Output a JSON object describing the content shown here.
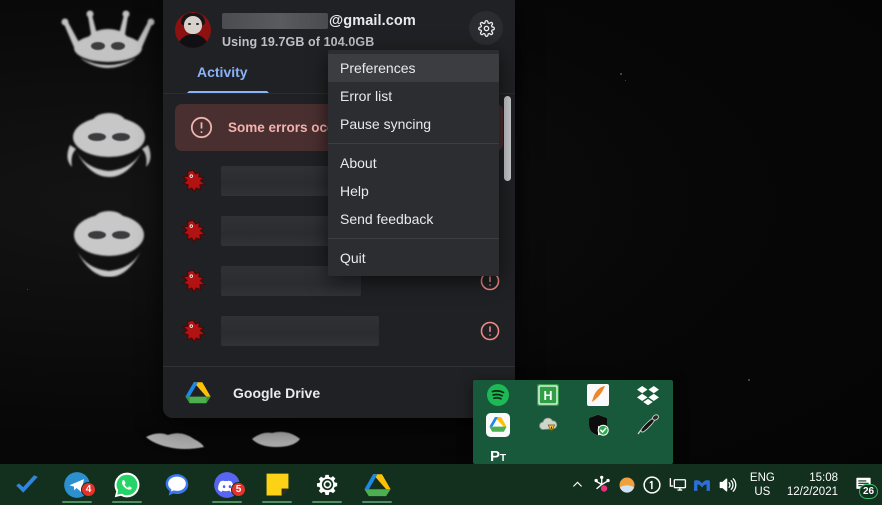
{
  "desktop": {
    "wallpaper_name": "abstract-white-fractal-forms-on-black",
    "background_color": "#060606"
  },
  "drive_panel": {
    "account": {
      "email_redacted": "",
      "email_domain": "@gmail.com",
      "quota_text": "Using 19.7GB of 104.0GB",
      "avatar_name": "user-avatar"
    },
    "settings_icon": "gear-icon",
    "tabs": [
      {
        "label": "Activity",
        "selected": true
      }
    ],
    "error_banner": {
      "icon": "error-circle-icon",
      "text": "Some errors occurred",
      "background_color": "#4a2f30",
      "text_color": "#f3b2ae"
    },
    "error_rows": [
      {
        "icon": "red-blob-file-icon",
        "name_redacted": "",
        "status_icon": ""
      },
      {
        "icon": "red-blob-file-icon",
        "name_redacted": "",
        "status_icon": ""
      },
      {
        "icon": "red-blob-file-icon",
        "name_redacted": "",
        "status_icon": "error-circle-icon"
      },
      {
        "icon": "red-blob-file-icon",
        "name_redacted": "",
        "status_icon": "error-circle-icon"
      }
    ],
    "footer": {
      "icon": "google-drive-icon",
      "label": "Google Drive"
    },
    "scrollbar": {
      "name": "vertical-scrollbar",
      "color": "#c9cace"
    }
  },
  "context_menu": {
    "highlighted_index": 0,
    "groups": [
      [
        {
          "label": "Preferences"
        },
        {
          "label": "Error list"
        },
        {
          "label": "Pause syncing"
        }
      ],
      [
        {
          "label": "About"
        },
        {
          "label": "Help"
        },
        {
          "label": "Send feedback"
        }
      ],
      [
        {
          "label": "Quit"
        }
      ]
    ]
  },
  "tray_flyout": {
    "background_color": "#17593a",
    "icons": [
      {
        "name": "spotify-icon"
      },
      {
        "name": "hyper-h-icon"
      },
      {
        "name": "orange-swoosh-icon"
      },
      {
        "name": "dropbox-icon"
      },
      {
        "name": "google-drive-icon"
      },
      {
        "name": "warning-cloud-icon"
      },
      {
        "name": "shield-check-icon"
      },
      {
        "name": "audio-speaker-icon"
      },
      {
        "name": "pt-text-icon",
        "label": "P",
        "sub": "T"
      }
    ]
  },
  "taskbar": {
    "background_color": "#13301f",
    "left_items": [
      {
        "name": "todoist-check-icon",
        "badge": "",
        "running": false
      },
      {
        "name": "telegram-icon",
        "badge": "4",
        "running": true
      },
      {
        "name": "whatsapp-icon",
        "badge": "",
        "running": true
      },
      {
        "name": "signal-icon",
        "badge": "",
        "running": false
      },
      {
        "name": "discord-icon",
        "badge": "5",
        "running": true
      },
      {
        "name": "sticky-notes-icon",
        "badge": "",
        "running": true
      },
      {
        "name": "settings-gear-icon",
        "badge": "",
        "running": true
      },
      {
        "name": "google-drive-icon",
        "badge": "",
        "running": true
      }
    ],
    "tray": [
      {
        "name": "show-hidden-icons-chevron"
      },
      {
        "name": "pink-dot-app-icon"
      },
      {
        "name": "orange-sphere-icon"
      },
      {
        "name": "onepassword-icon"
      },
      {
        "name": "remote-display-icon"
      },
      {
        "name": "malwarebytes-m-icon"
      },
      {
        "name": "volume-icon"
      }
    ],
    "language": {
      "line1": "ENG",
      "line2": "US"
    },
    "clock": {
      "time": "15:08",
      "date": "12/2/2021"
    },
    "notifications": {
      "name": "notification-center",
      "count": "26"
    }
  }
}
